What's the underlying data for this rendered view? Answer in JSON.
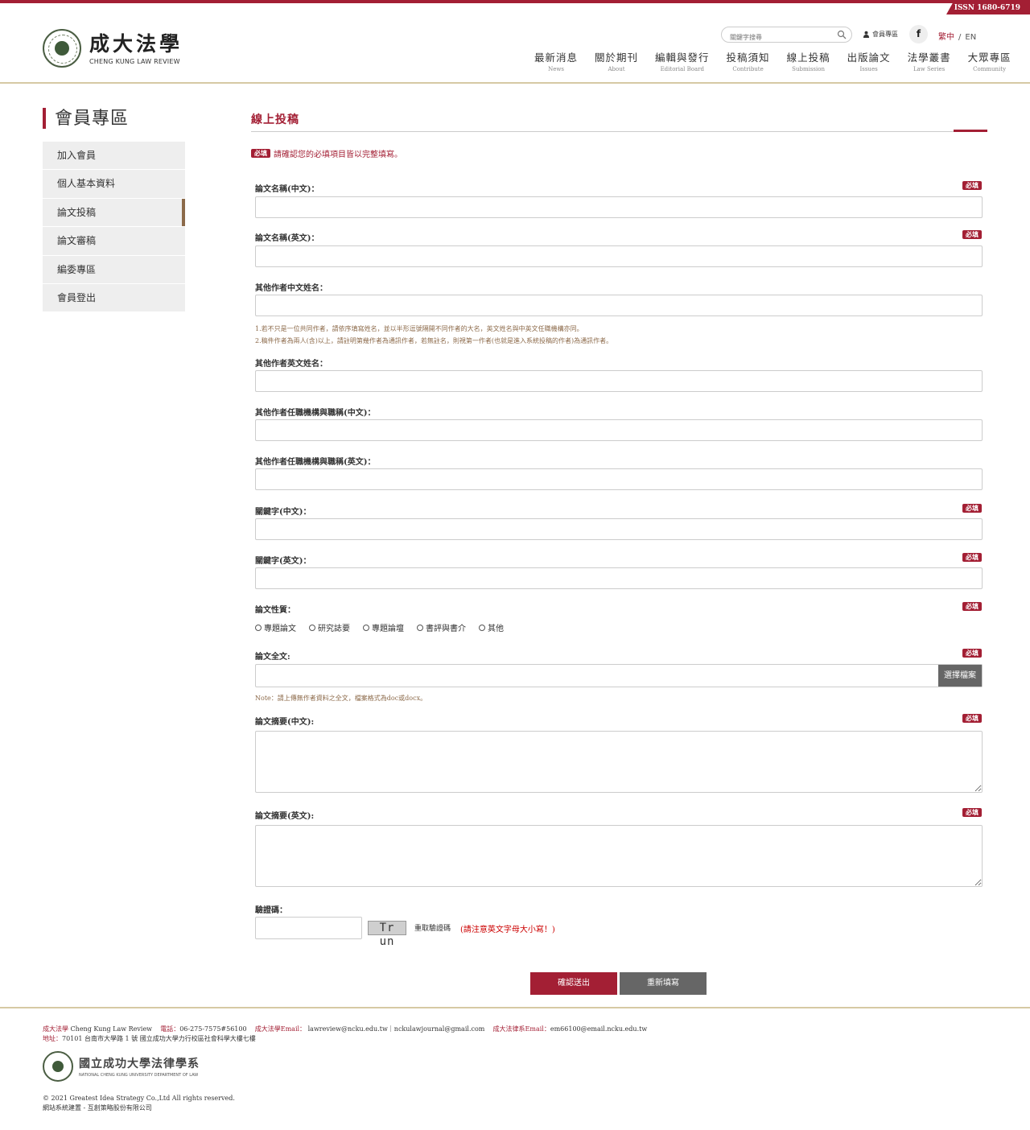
{
  "issn": "ISSN 1680-6719",
  "logo": {
    "zh": "成大法學",
    "en": "CHENG KUNG LAW REVIEW"
  },
  "header": {
    "search_placeholder": "關鍵字搜尋",
    "member_link": "會員專區",
    "facebook": "f",
    "lang_zh": "繁中",
    "lang_sep": "/",
    "lang_en": "EN"
  },
  "nav": [
    {
      "zh": "最新消息",
      "en": "News"
    },
    {
      "zh": "關於期刊",
      "en": "About"
    },
    {
      "zh": "編輯與發行",
      "en": "Editorial Board"
    },
    {
      "zh": "投稿須知",
      "en": "Contribute"
    },
    {
      "zh": "線上投稿",
      "en": "Submission"
    },
    {
      "zh": "出版論文",
      "en": "Issues"
    },
    {
      "zh": "法學叢書",
      "en": "Law Series"
    },
    {
      "zh": "大眾專區",
      "en": "Community"
    }
  ],
  "sidebar": {
    "title": "會員專區",
    "items": [
      {
        "label": "加入會員"
      },
      {
        "label": "個人基本資料"
      },
      {
        "label": "論文投稿"
      },
      {
        "label": "論文審稿"
      },
      {
        "label": "編委專區"
      },
      {
        "label": "會員登出"
      }
    ]
  },
  "main": {
    "title": "線上投稿",
    "required_badge": "必填",
    "required_note": "請確認您的必填項目皆以完整填寫。"
  },
  "fields": {
    "title_zh": "論文名稱(中文)：",
    "title_en": "論文名稱(英文)：",
    "coauthor_zh": "其他作者中文姓名：",
    "coauthor_hint_1": "1.若不只是一位共同作者，請依序填寫姓名，並以半形逗號隔開不同作者的大名，英文姓名與中英文任職機構亦同。",
    "coauthor_hint_2": "2.稿件作者為兩人(含)以上，請註明第幾作者為通訊作者，若無註名，則視第一作者(也就是進入系統投稿的作者)為通訊作者。",
    "coauthor_en": "其他作者英文姓名：",
    "affiliation_zh": "其他作者任職機構與職稱(中文)：",
    "affiliation_en": "其他作者任職機構與職稱(英文)：",
    "keywords_zh": "關鍵字(中文)：",
    "keywords_en": "關鍵字(英文)：",
    "paper_type": "論文性質：",
    "paper_type_options": [
      "專題論文",
      "研究誌要",
      "專題論壇",
      "書評與書介",
      "其他"
    ],
    "fulltext": "論文全文:",
    "file_button": "選擇檔案",
    "fulltext_note": "Note：請上傳無作者資料之全文，檔案格式為doc或docx。",
    "abstract_zh": "論文摘要(中文):",
    "abstract_en": "論文摘要(英文):",
    "captcha": "驗證碼：",
    "captcha_text": "Tr un",
    "captcha_refresh": "重取驗證碼",
    "captcha_warn": "(請注意英文字母大小寫！)"
  },
  "buttons": {
    "submit": "確認送出",
    "reset": "重新填寫"
  },
  "footer": {
    "brand_label": "成大法學",
    "brand": "Cheng Kung Law Review",
    "tel_label": "電話：",
    "tel": "06-275-7575#56100",
    "email_label": "成大法學Email：",
    "email": "lawreview@ncku.edu.tw｜nckulawjournal@gmail.com",
    "dept_email_label": "成大法律系Email：",
    "dept_email": "em66100@email.ncku.edu.tw",
    "address_label": "地址：",
    "address": "70101 台南市大學路 1 號 國立成功大學力行校區社會科學大樓七樓",
    "dept_zh": "國立成功大學法律學系",
    "dept_en": "NATIONAL CHENG KUNG UNIVERSITY DEPARTMENT OF LAW",
    "copyright": "© 2021 Greatest Idea Strategy Co.,Ltd All rights reserved.",
    "builder": "網站系統建置 - 互創策略股份有限公司"
  },
  "colors": {
    "brand": "#a31f34",
    "accent_line": "#d6c9a4",
    "sidebar_bg": "#eeeeee"
  }
}
